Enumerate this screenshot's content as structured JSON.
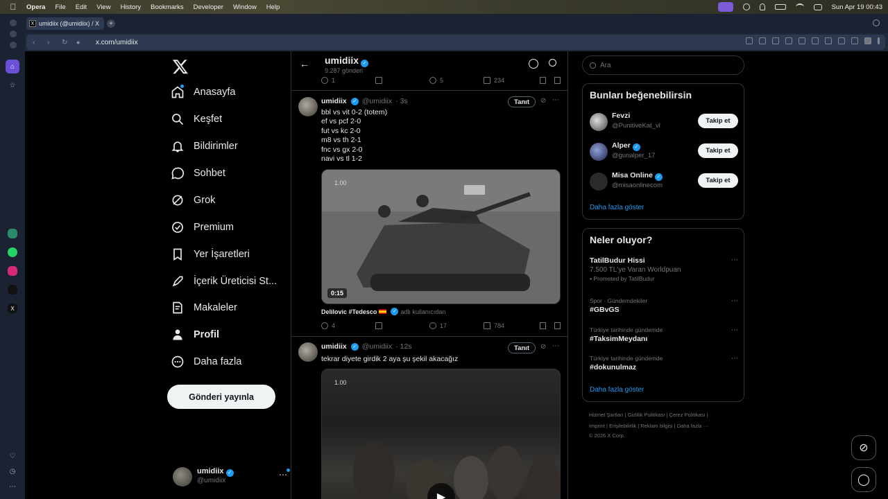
{
  "menubar": {
    "app": "Opera",
    "items": [
      "File",
      "Edit",
      "View",
      "History",
      "Bookmarks",
      "Developer",
      "Window",
      "Help"
    ],
    "clock": "Sun Apr 19  00:43"
  },
  "browser": {
    "tab_title": "umidiix (@umidiix) / X",
    "url": "x.com/umidiix"
  },
  "nav": {
    "items": [
      {
        "label": "Anasayfa",
        "icon": "home-icon"
      },
      {
        "label": "Keşfet",
        "icon": "search-icon"
      },
      {
        "label": "Bildirimler",
        "icon": "bell-icon"
      },
      {
        "label": "Sohbet",
        "icon": "chat-icon"
      },
      {
        "label": "Grok",
        "icon": "grok-icon"
      },
      {
        "label": "Premium",
        "icon": "premium-icon"
      },
      {
        "label": "Yer İşaretleri",
        "icon": "bookmark-icon"
      },
      {
        "label": "İçerik Üreticisi St...",
        "icon": "rocket-icon"
      },
      {
        "label": "Makaleler",
        "icon": "articles-icon"
      },
      {
        "label": "Profil",
        "icon": "person-icon"
      },
      {
        "label": "Daha fazla",
        "icon": "more-circle-icon"
      }
    ],
    "post_button": "Gönderi yayınla",
    "account_name": "umidiix",
    "account_handle": "@umidiix"
  },
  "timeline": {
    "title": "umidiix",
    "subtitle": "9.287 gönderi",
    "top_actions": {
      "replies": "1",
      "likes": "5",
      "views": "234"
    },
    "tweets": [
      {
        "name": "umidiix",
        "handle": "@umidiix",
        "time": "3s",
        "follow_label": "Tanıt",
        "text": "bbl vs vit 0-2 (totem)\nef vs pcf 2-0\nfut vs kc 2-0\nm8 vs th 2-1\nfnc vs gx 2-0\nnavi vs tl 1-2",
        "video_rate": "1.00",
        "video_duration": "0:15",
        "attribution_name": "Delilovic #Tedesco",
        "attribution_suffix": "adlı kullanıcıdan",
        "replies": "4",
        "likes": "17",
        "views": "784"
      },
      {
        "name": "umidiix",
        "handle": "@umidiix",
        "time": "12s",
        "follow_label": "Tanıt",
        "text": "tekrar diyete girdik 2 aya şu şekil akacağız",
        "video_rate": "1.00"
      }
    ]
  },
  "right": {
    "search_placeholder": "Ara",
    "who_to_follow": {
      "title": "Bunları beğenebilirsin",
      "users": [
        {
          "name": "Fevzi",
          "handle": "@PunitiveKat_vl",
          "verified": false,
          "button": "Takip et"
        },
        {
          "name": "Alper",
          "handle": "@gunalper_17",
          "verified": true,
          "button": "Takip et"
        },
        {
          "name": "Misa Online",
          "handle": "@misaonlinecom",
          "verified": true,
          "button": "Takip et"
        }
      ],
      "show_more": "Daha fazla göster"
    },
    "trends": {
      "title": "Neler oluyor?",
      "items": [
        {
          "context": "",
          "title": "TatilBudur Hissi",
          "subtitle": "7.500 TL'ye Varan Worldpuan",
          "promo": "Promoted by TatilBudur"
        },
        {
          "context": "Spor · Gündemdekiler",
          "title": "#GBvGS",
          "subtitle": "",
          "promo": ""
        },
        {
          "context": "Türkiye tarihinde gündemde",
          "title": "#TaksimMeydanı",
          "subtitle": "",
          "promo": ""
        },
        {
          "context": "Türkiye tarihinde gündemde",
          "title": "#dokunulmaz",
          "subtitle": "",
          "promo": ""
        }
      ],
      "show_more": "Daha fazla göster"
    },
    "footer": {
      "line1": "Hizmet Şartları  |  Gizlilik Politikası  |  Çerez Politikası  |",
      "line2": "Imprint  |  Erişilebilirlik  |  Reklam bilgisi  |  Daha fazla ···",
      "line3": "© 2026 X Corp."
    }
  },
  "colors": {
    "accent": "#1d9bf0",
    "background": "#000000",
    "border": "#2f3336",
    "muted": "#71767b"
  }
}
